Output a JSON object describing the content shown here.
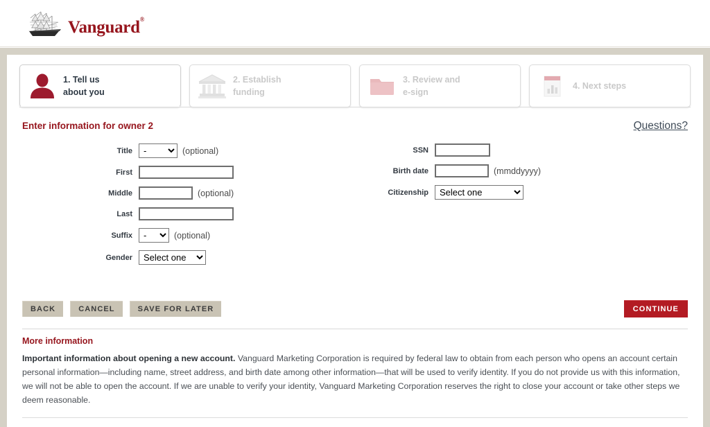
{
  "brand": {
    "name": "Vanguard",
    "trademark": "®",
    "logo_icon": "sailing-ship-icon",
    "color": "#96151d"
  },
  "steps": [
    {
      "label": "1. Tell us\nabout you",
      "icon": "person-silhouette-icon",
      "state": "active"
    },
    {
      "label": "2. Establish\nfunding",
      "icon": "bank-building-icon",
      "state": "inactive"
    },
    {
      "label": "3. Review and\ne-sign",
      "icon": "folder-icon",
      "state": "inactive"
    },
    {
      "label": "4. Next steps",
      "icon": "bar-chart-document-icon",
      "state": "inactive"
    }
  ],
  "form": {
    "title": "Enter information for owner 2",
    "questions_link": "Questions?",
    "left_fields": [
      {
        "label": "Title",
        "control": "select",
        "value": "-",
        "hint": "(optional)"
      },
      {
        "label": "First",
        "control": "input",
        "value": "",
        "hint": ""
      },
      {
        "label": "Middle",
        "control": "input",
        "value": "",
        "hint": "(optional)"
      },
      {
        "label": "Last",
        "control": "input",
        "value": "",
        "hint": ""
      },
      {
        "label": "Suffix",
        "control": "select",
        "value": "-",
        "hint": "(optional)"
      },
      {
        "label": "Gender",
        "control": "select",
        "value": "Select one",
        "hint": ""
      }
    ],
    "right_fields": [
      {
        "label": "SSN",
        "control": "input",
        "value": "",
        "hint": ""
      },
      {
        "label": "Birth date",
        "control": "input",
        "value": "",
        "hint": "(mmddyyyy)"
      },
      {
        "label": "Citizenship",
        "control": "select",
        "value": "Select one",
        "hint": ""
      }
    ]
  },
  "buttons": {
    "back": "BACK",
    "cancel": "CANCEL",
    "save_for_later": "SAVE FOR LATER",
    "continue": "CONTINUE",
    "continue_color": "#b31b23",
    "secondary_color": "#c9c3b4"
  },
  "more_information": {
    "heading": "More information",
    "lead": "Important information about opening a new account.",
    "body": " Vanguard Marketing Corporation is required by federal law to obtain from each person who opens an account certain personal information—including name, street address, and birth date among other information—that will be used to verify identity. If you do not provide us with this information, we will not be able to open the account. If we are unable to verify your identity, Vanguard Marketing Corporation reserves the right to close your account or take other steps we deem reasonable."
  }
}
